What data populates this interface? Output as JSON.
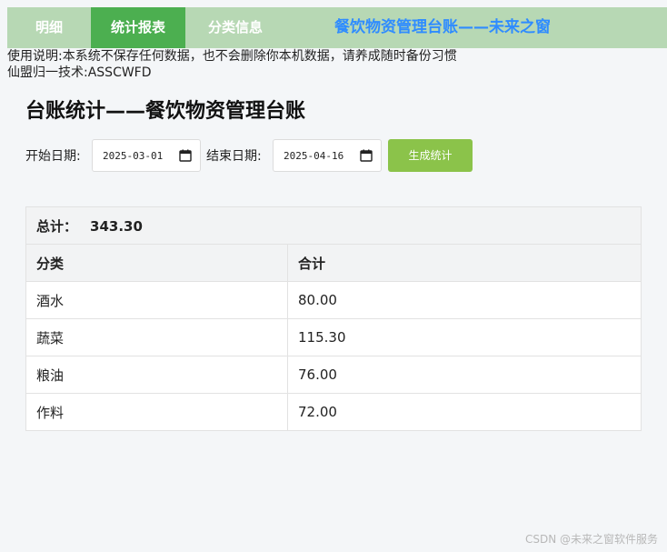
{
  "nav": {
    "tabs": [
      {
        "label": "明细"
      },
      {
        "label": "统计报表"
      },
      {
        "label": "分类信息"
      }
    ],
    "active_tab": "统计报表",
    "app_title": "餐饮物资管理台账——未来之窗"
  },
  "notice": {
    "line1": "使用说明:本系统不保存任何数据，也不会删除你本机数据，请养成随时备份习惯",
    "line2": "仙盟归一技术:ASSCWFD"
  },
  "heading": "台账统计——餐饮物资管理台账",
  "filters": {
    "start_label": "开始日期:",
    "start_value": "2025-03-01",
    "end_label": "结束日期:",
    "end_value": "2025-04-16",
    "button_label": "生成统计"
  },
  "summary": {
    "total_label": "总计：",
    "total_value": "343.30"
  },
  "table": {
    "columns": [
      "分类",
      "合计"
    ],
    "rows": [
      [
        "酒水",
        "80.00"
      ],
      [
        "蔬菜",
        "115.30"
      ],
      [
        "粮油",
        "76.00"
      ],
      [
        "作料",
        "72.00"
      ]
    ]
  },
  "watermark": "CSDN @未来之窗软件服务",
  "colors": {
    "nav_bg": "#b7d8b4",
    "active_tab": "#4caf50",
    "title_blue": "#2f8cff",
    "button_green": "#8bc34a"
  },
  "icons": {
    "date_picker": "calendar-icon"
  }
}
